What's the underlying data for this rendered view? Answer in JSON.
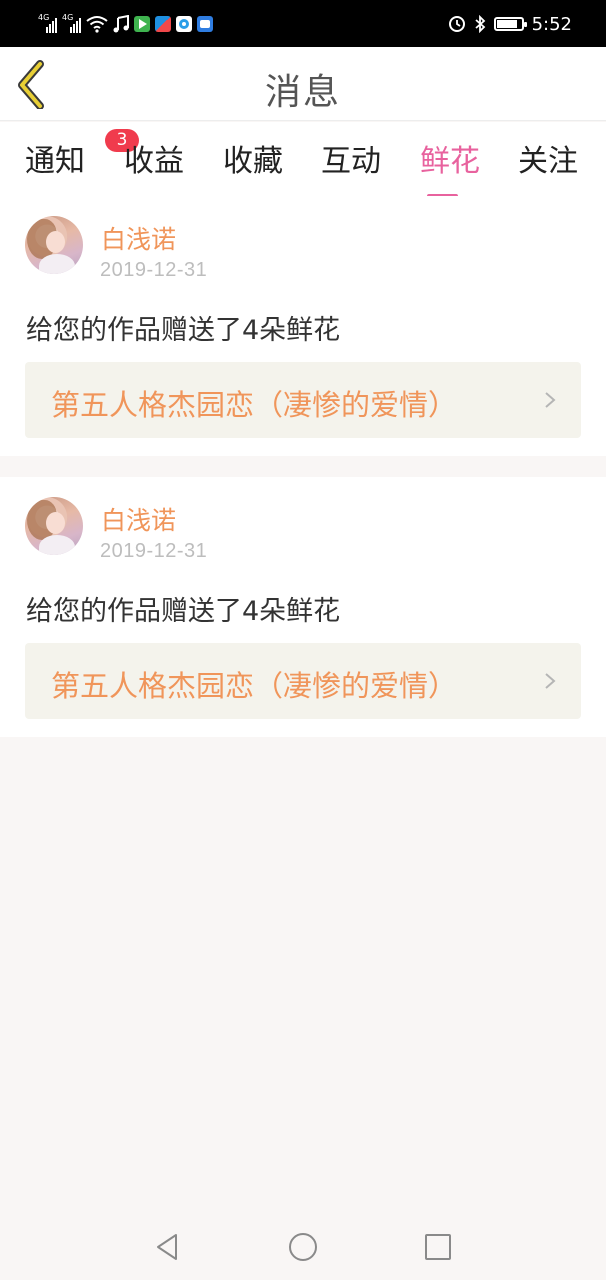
{
  "status_bar": {
    "network_labels": [
      "4G",
      "4G"
    ],
    "time": "5:52",
    "battery_level": 0.8,
    "icons": [
      "signal-icon",
      "signal-icon",
      "wifi-icon",
      "music-icon",
      "video-app-icon",
      "tv-app-icon",
      "browser-app-icon",
      "news-app-icon",
      "alarm-icon",
      "bluetooth-icon",
      "battery-icon"
    ]
  },
  "header": {
    "title": "消息",
    "back_icon": "chevron-left-icon"
  },
  "tabs": [
    {
      "label": "通知",
      "badge": "3"
    },
    {
      "label": "收益"
    },
    {
      "label": "收藏"
    },
    {
      "label": "互动"
    },
    {
      "label": "鲜花",
      "active": true
    },
    {
      "label": "关注"
    }
  ],
  "messages": [
    {
      "user": "白浅诺",
      "date": "2019-12-31",
      "text": "给您的作品赠送了4朵鲜花",
      "work_title": "第五人格杰园恋（凄惨的爱情）"
    },
    {
      "user": "白浅诺",
      "date": "2019-12-31",
      "text": "给您的作品赠送了4朵鲜花",
      "work_title": "第五人格杰园恋（凄惨的爱情）"
    }
  ],
  "colors": {
    "accent": "#e8629e",
    "name_orange": "#f0955a",
    "badge_red": "#f03b4d",
    "back_yellow": "#e8cf35",
    "link_bg": "#f4f3ec"
  },
  "nav_bar": {
    "icons": [
      "back-triangle-icon",
      "home-circle-icon",
      "recents-square-icon"
    ]
  }
}
